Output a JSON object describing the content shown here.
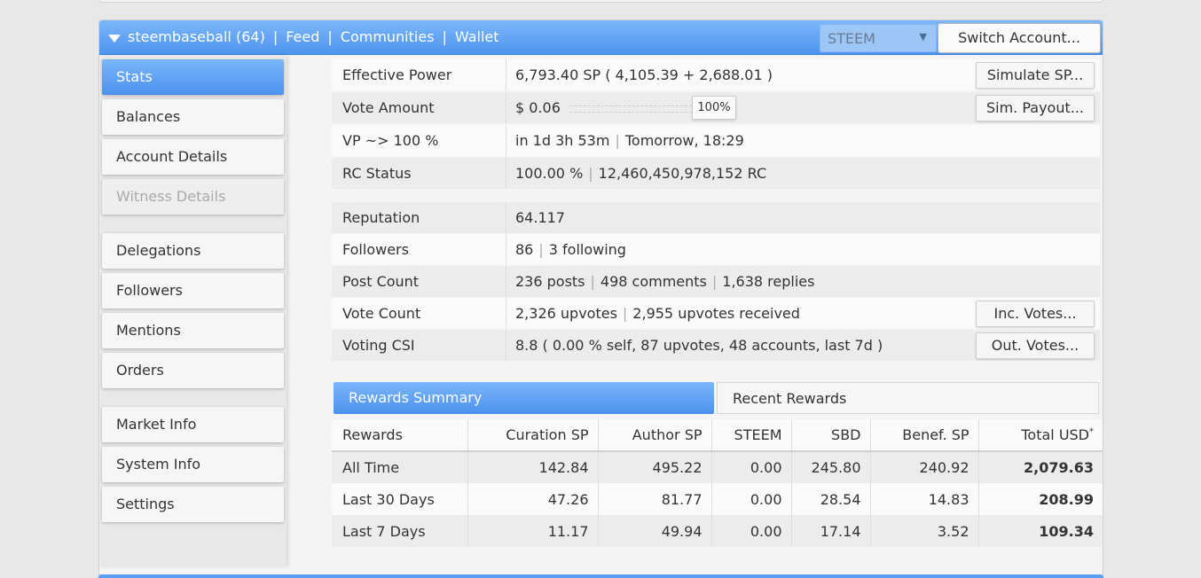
{
  "header": {
    "account": "steembaseball (64)",
    "nav": [
      "Feed",
      "Communities",
      "Wallet"
    ],
    "currency": "STEEM",
    "switch_label": "Switch Account..."
  },
  "sidebar": {
    "items": [
      {
        "label": "Stats"
      },
      {
        "label": "Balances"
      },
      {
        "label": "Account Details"
      },
      {
        "label": "Witness Details"
      },
      {
        "label": "Delegations"
      },
      {
        "label": "Followers"
      },
      {
        "label": "Mentions"
      },
      {
        "label": "Orders"
      },
      {
        "label": "Market Info"
      },
      {
        "label": "System Info"
      },
      {
        "label": "Settings"
      }
    ]
  },
  "stats": {
    "effective_power": {
      "label": "Effective Power",
      "value": "6,793.40 SP",
      "detail": "( 4,105.39 + 2,688.01 )",
      "button": "Simulate SP..."
    },
    "vote_amount": {
      "label": "Vote Amount",
      "value": "$ 0.06",
      "pct": "100%",
      "button": "Sim. Payout..."
    },
    "vp": {
      "label": "VP ~> 100 %",
      "value1": "in 1d 3h 53m",
      "value2": "Tomorrow, 18:29"
    },
    "rc": {
      "label": "RC Status",
      "value1": "100.00 %",
      "value2": "12,460,450,978,152 RC"
    },
    "reputation": {
      "label": "Reputation",
      "value": "64.117"
    },
    "followers": {
      "label": "Followers",
      "value1": "86",
      "value2": "3 following"
    },
    "post_count": {
      "label": "Post Count",
      "value1": "236 posts",
      "value2": "498 comments",
      "value3": "1,638 replies"
    },
    "vote_count": {
      "label": "Vote Count",
      "value1": "2,326 upvotes",
      "value2": "2,955 upvotes received",
      "button": "Inc. Votes..."
    },
    "voting_csi": {
      "label": "Voting CSI",
      "value": "8.8 ( 0.00 % self, 87 upvotes, 48 accounts, last 7d )",
      "button": "Out. Votes..."
    }
  },
  "tabs": {
    "summary": "Rewards Summary",
    "recent": "Recent Rewards"
  },
  "rewards": {
    "headers": [
      "Rewards",
      "Curation SP",
      "Author SP",
      "STEEM",
      "SBD",
      "Benef. SP",
      "Total USD"
    ],
    "total_marker": "*",
    "rows": [
      [
        "All Time",
        "142.84",
        "495.22",
        "0.00",
        "245.80",
        "240.92",
        "2,079.63"
      ],
      [
        "Last 30 Days",
        "47.26",
        "81.77",
        "0.00",
        "28.54",
        "14.83",
        "208.99"
      ],
      [
        "Last 7 Days",
        "11.17",
        "49.94",
        "0.00",
        "17.14",
        "3.52",
        "109.34"
      ]
    ]
  }
}
